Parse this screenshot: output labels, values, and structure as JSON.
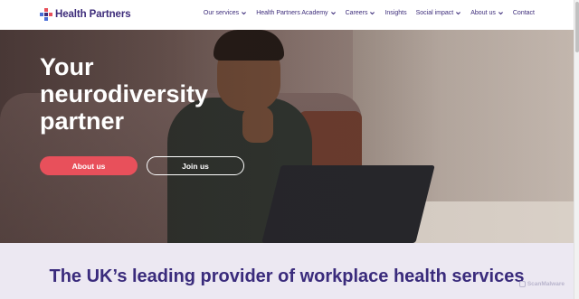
{
  "header": {
    "logo_text": "Health Partners",
    "brand_colors": {
      "purple": "#3d2c7a",
      "red": "#e8505b",
      "blue": "#4a6fd8"
    },
    "nav": [
      {
        "label": "Our services",
        "has_dropdown": true
      },
      {
        "label": "Health Partners Academy",
        "has_dropdown": true
      },
      {
        "label": "Careers",
        "has_dropdown": true
      },
      {
        "label": "Insights",
        "has_dropdown": false
      },
      {
        "label": "Social impact",
        "has_dropdown": true
      },
      {
        "label": "About us",
        "has_dropdown": true
      },
      {
        "label": "Contact",
        "has_dropdown": false
      }
    ]
  },
  "hero": {
    "title": "Your neurodiversity partner",
    "primary_button": "About us",
    "secondary_button": "Join us",
    "image": "man-with-earbuds-using-laptop-on-sofa"
  },
  "section": {
    "heading": "The UK’s leading provider of workplace health services"
  },
  "watermark": {
    "text": "ScanMalware",
    "icon": "scanmalware-logo-icon"
  }
}
